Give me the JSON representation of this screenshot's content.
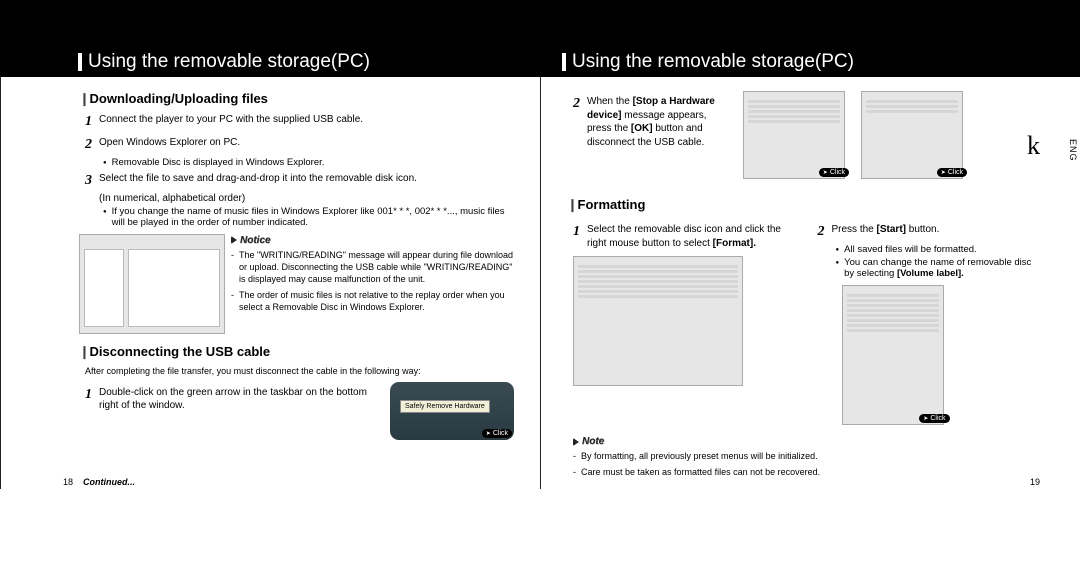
{
  "titles": {
    "left": "Using the removable storage(PC)",
    "right": "Using the removable storage(PC)"
  },
  "lang_tab": "ENG",
  "left_page": {
    "section1": {
      "heading": "Downloading/Uploading files",
      "step1": "Connect the player to your PC with the supplied USB cable.",
      "step2": "Open Windows Explorer on PC.",
      "sub2": "Removable Disc is displayed in Windows Explorer.",
      "step3a": "Select the file to save and drag-and-drop it into the removable disk icon.",
      "step3b": "(In numerical, alphabetical order)",
      "sub3": "If you change the name of music files in Windows Explorer like 001* * *, 002* * *..., music files will be played in the order of number indicated.",
      "notice_label": "Notice",
      "notice1": "The \"WRITING/READING\" message will appear during file download or upload. Disconnecting the USB cable while \"WRITING/READING\" is displayed may cause malfunction of the unit.",
      "notice2": "The order of music files is not relative to the replay order when you select a Removable Disc in Windows Explorer."
    },
    "section2": {
      "heading": "Disconnecting the USB cable",
      "intro": "After completing the file transfer, you must disconnect the cable in the following way:",
      "step1": "Double-click on the green arrow in the taskbar on the bottom right of the window.",
      "bubble": "Safely Remove Hardware",
      "click": "Click"
    },
    "page_num": "18",
    "continued": "Continued..."
  },
  "right_page": {
    "top": {
      "step2_a": "When the",
      "step2_b": "[Stop a Hardware device]",
      "step2_c": "message appears, press the",
      "step2_d": "[OK]",
      "step2_e": "button and disconnect the USB cable.",
      "click": "Click",
      "k": "k"
    },
    "section1": {
      "heading": "Formatting",
      "step1": "Select the removable disc icon and click the right mouse button to select",
      "step1_b": "[Format].",
      "step2": "Press the",
      "step2_b": "[Start]",
      "step2_c": "button.",
      "sub2a": "All saved files will be formatted.",
      "sub2b": "You can change the name of removable disc by selecting",
      "sub2b_b": "[Volume label].",
      "click": "Click"
    },
    "note": {
      "label": "Note",
      "n1": "By formatting, all previously preset menus will be initialized.",
      "n2": "Care must be taken as formatted files can not be recovered."
    },
    "page_num": "19"
  }
}
